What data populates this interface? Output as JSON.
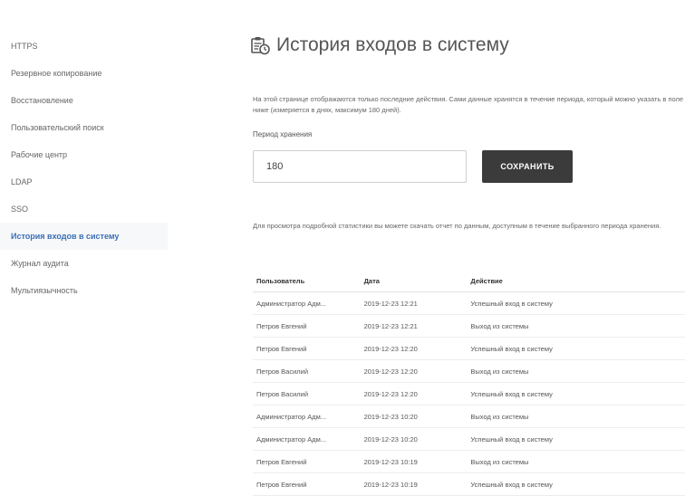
{
  "sidebar": {
    "items": [
      {
        "label": "HTTPS"
      },
      {
        "label": "Резервное копирование"
      },
      {
        "label": "Восстановление"
      },
      {
        "label": "Пользовательский поиск"
      },
      {
        "label": "Рабочие центр"
      },
      {
        "label": "LDAP"
      },
      {
        "label": "SSO"
      },
      {
        "label": "История входов в систему",
        "active": true
      },
      {
        "label": "Журнал аудита"
      },
      {
        "label": "Мультиязычность"
      }
    ]
  },
  "header": {
    "title": "История входов в систему",
    "icon": "login-history-icon"
  },
  "description": "На этой странице отображаются только последние действия. Сами данные хранятся в течение периода, который можно указать в поле ниже (измеряется в днях, максимум 180 дней).",
  "period": {
    "label": "Период хранения",
    "value": "180",
    "save_label": "СОХРАНИТЬ"
  },
  "info": "Для просмотра подробной статистики вы можете скачать отчет по данным, доступным в течение выбранного периода хранения.",
  "table": {
    "headers": [
      "Пользователь",
      "Дата",
      "Действие"
    ],
    "rows": [
      [
        "Администратор Адм...",
        "2019-12-23 12:21",
        "Успешный вход в систему"
      ],
      [
        "Петров Евгений",
        "2019-12-23 12:21",
        "Выход из системы"
      ],
      [
        "Петров Евгений",
        "2019-12-23 12:20",
        "Успешный вход в систему"
      ],
      [
        "Петров Василий",
        "2019-12-23 12:20",
        "Выход из системы"
      ],
      [
        "Петров Василий",
        "2019-12-23 12:20",
        "Успешный вход в систему"
      ],
      [
        "Администратор Адм...",
        "2019-12-23 10:20",
        "Выход из системы"
      ],
      [
        "Администратор Адм...",
        "2019-12-23 10:20",
        "Успешный вход в систему"
      ],
      [
        "Петров Евгений",
        "2019-12-23 10:19",
        "Выход из системы"
      ],
      [
        "Петров Евгений",
        "2019-12-23 10:19",
        "Успешный вход в систему"
      ]
    ]
  },
  "colors": {
    "accent": "#3a6fb5",
    "button": "#3b3b3b",
    "text": "#444444"
  }
}
